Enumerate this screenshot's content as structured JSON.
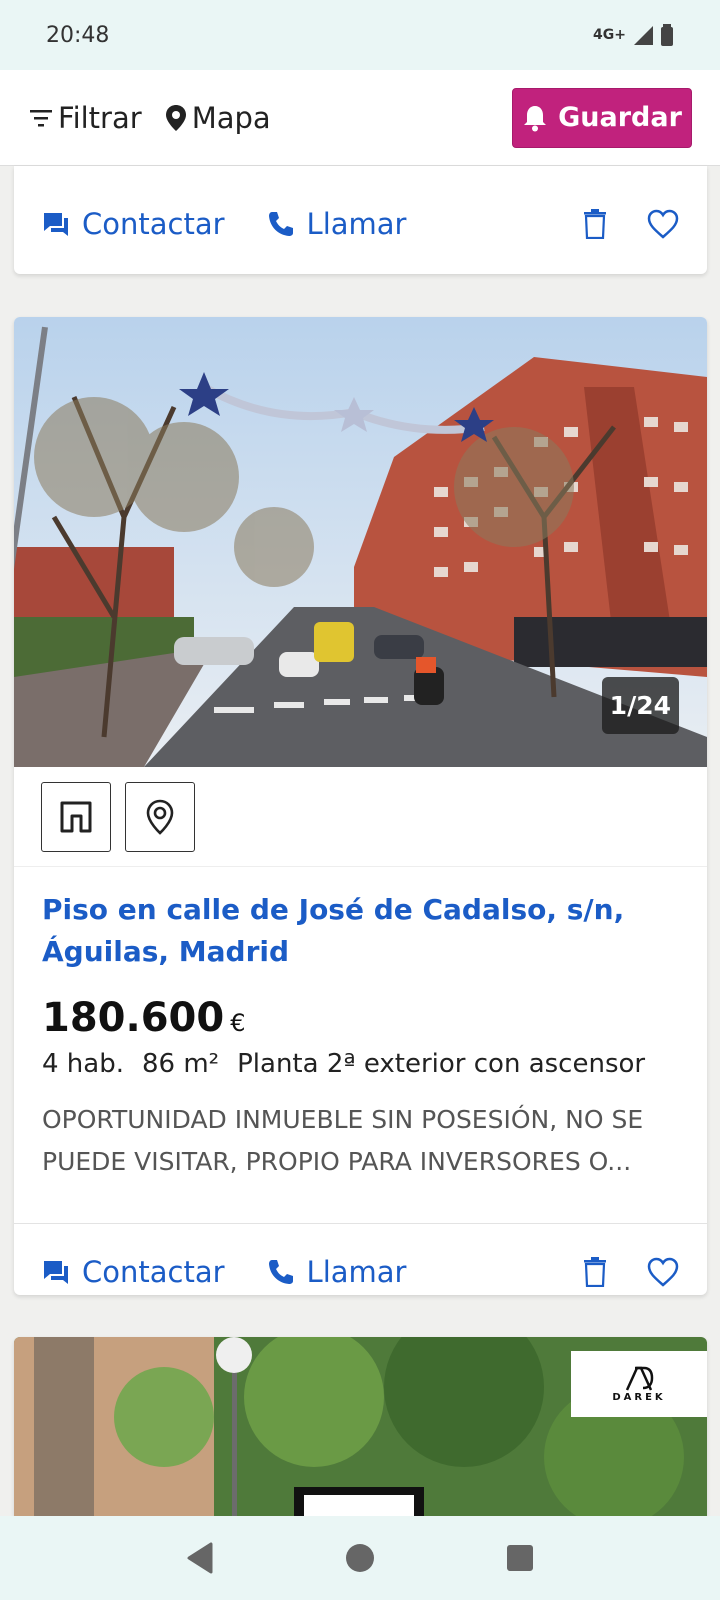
{
  "status": {
    "time": "20:48",
    "network": "4G+"
  },
  "toolbar": {
    "filter_label": "Filtrar",
    "map_label": "Mapa",
    "save_label": "Guardar"
  },
  "actions": {
    "contact_label": "Contactar",
    "call_label": "Llamar"
  },
  "listing": {
    "photo_counter": "1/24",
    "title": "Piso en calle de José de Cadalso, s/n, Águilas, Madrid",
    "price": "180.600",
    "currency": "€",
    "rooms": "4 hab.",
    "area": "86 m²",
    "floor": "Planta 2ª exterior con ascensor",
    "description": "OPORTUNIDAD INMUEBLE SIN POSESIÓN, NO SE PUEDE VISITAR, PROPIO PARA INVERSORES O..."
  },
  "next_listing": {
    "agency_logo_text": "DAREK"
  },
  "colors": {
    "accent": "#1b5cc6",
    "save": "#c1227d"
  }
}
